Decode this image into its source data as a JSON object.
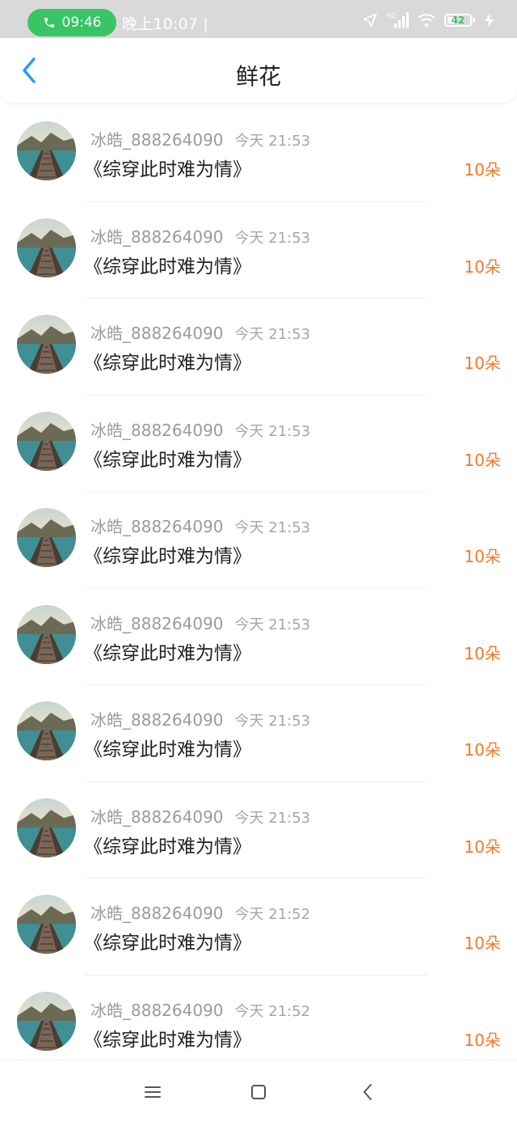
{
  "status_bar": {
    "call_time": "09:46",
    "clock": "晚上10:07 |",
    "hd_label": "HD",
    "battery": "42",
    "battery_level": 0.42
  },
  "header": {
    "title": "鲜花"
  },
  "items": [
    {
      "user": "冰皓_888264090",
      "time": "今天 21:53",
      "book": "《综穿此时难为情》",
      "amount": "10朵"
    },
    {
      "user": "冰皓_888264090",
      "time": "今天 21:53",
      "book": "《综穿此时难为情》",
      "amount": "10朵"
    },
    {
      "user": "冰皓_888264090",
      "time": "今天 21:53",
      "book": "《综穿此时难为情》",
      "amount": "10朵"
    },
    {
      "user": "冰皓_888264090",
      "time": "今天 21:53",
      "book": "《综穿此时难为情》",
      "amount": "10朵"
    },
    {
      "user": "冰皓_888264090",
      "time": "今天 21:53",
      "book": "《综穿此时难为情》",
      "amount": "10朵"
    },
    {
      "user": "冰皓_888264090",
      "time": "今天 21:53",
      "book": "《综穿此时难为情》",
      "amount": "10朵"
    },
    {
      "user": "冰皓_888264090",
      "time": "今天 21:53",
      "book": "《综穿此时难为情》",
      "amount": "10朵"
    },
    {
      "user": "冰皓_888264090",
      "time": "今天 21:53",
      "book": "《综穿此时难为情》",
      "amount": "10朵"
    },
    {
      "user": "冰皓_888264090",
      "time": "今天 21:52",
      "book": "《综穿此时难为情》",
      "amount": "10朵"
    },
    {
      "user": "冰皓_888264090",
      "time": "今天 21:52",
      "book": "《综穿此时难为情》",
      "amount": "10朵"
    }
  ],
  "nav": {
    "icons": [
      "menu-icon",
      "home-square-icon",
      "back-chevron-icon"
    ]
  },
  "colors": {
    "accent": "#2f9bf0",
    "amount": "#ef7a2b",
    "call_pill": "#39c465"
  }
}
